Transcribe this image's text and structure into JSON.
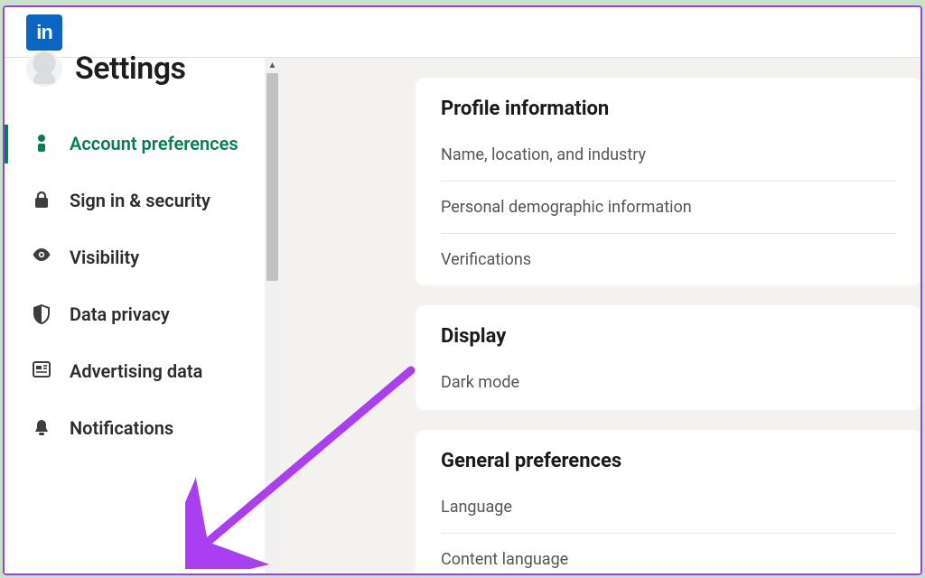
{
  "brand": {
    "logo_text": "in"
  },
  "page": {
    "title": "Settings"
  },
  "sidebar": {
    "items": [
      {
        "key": "account-preferences",
        "label": "Account preferences",
        "icon": "person-icon",
        "active": true
      },
      {
        "key": "sign-in-security",
        "label": "Sign in & security",
        "icon": "lock-icon",
        "active": false
      },
      {
        "key": "visibility",
        "label": "Visibility",
        "icon": "eye-icon",
        "active": false
      },
      {
        "key": "data-privacy",
        "label": "Data privacy",
        "icon": "shield-icon",
        "active": false
      },
      {
        "key": "advertising-data",
        "label": "Advertising data",
        "icon": "news-icon",
        "active": false
      },
      {
        "key": "notifications",
        "label": "Notifications",
        "icon": "bell-icon",
        "active": false
      }
    ]
  },
  "sections": [
    {
      "title": "Profile information",
      "rows": [
        "Name, location, and industry",
        "Personal demographic information",
        "Verifications"
      ]
    },
    {
      "title": "Display",
      "rows": [
        "Dark mode"
      ]
    },
    {
      "title": "General preferences",
      "rows": [
        "Language",
        "Content language"
      ]
    }
  ],
  "annotation": {
    "arrow_color": "#a93ff0",
    "target": "notifications"
  }
}
